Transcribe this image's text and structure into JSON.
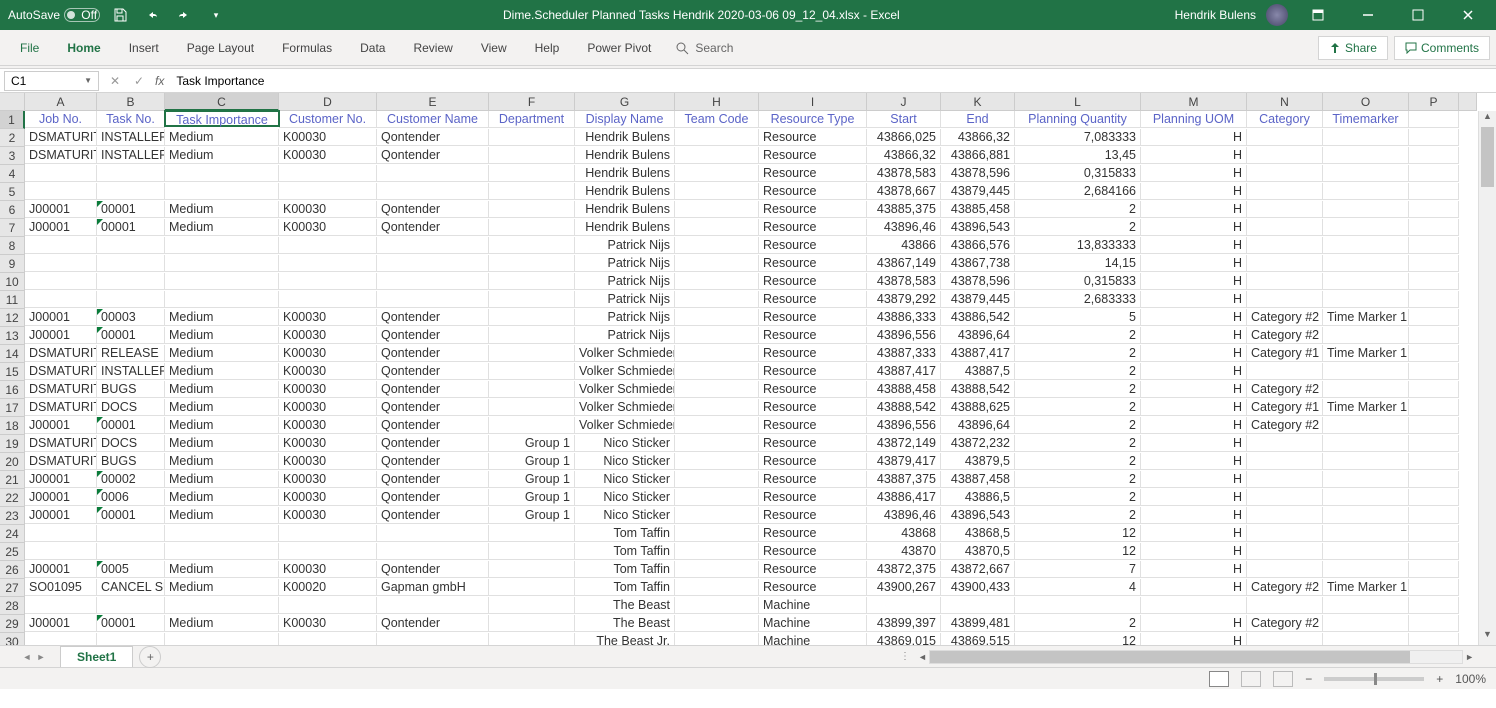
{
  "titlebar": {
    "autosave_label": "AutoSave",
    "autosave_off": "Off",
    "title": "Dime.Scheduler Planned Tasks Hendrik 2020-03-06 09_12_04.xlsx - Excel",
    "user": "Hendrik Bulens"
  },
  "ribbon": {
    "tabs": [
      "File",
      "Home",
      "Insert",
      "Page Layout",
      "Formulas",
      "Data",
      "Review",
      "View",
      "Help",
      "Power Pivot"
    ],
    "search_placeholder": "Search",
    "share": "Share",
    "comments": "Comments"
  },
  "formula_bar": {
    "name_box": "C1",
    "formula": "Task Importance"
  },
  "columns": [
    "A",
    "B",
    "C",
    "D",
    "E",
    "F",
    "G",
    "H",
    "I",
    "J",
    "K",
    "L",
    "M",
    "N",
    "O",
    "P"
  ],
  "headers": [
    "Job No.",
    "Task No.",
    "Task Importance",
    "Customer No.",
    "Customer Name",
    "Department",
    "Display Name",
    "Team Code",
    "Resource Type",
    "Start",
    "End",
    "Planning Quantity",
    "Planning UOM",
    "Category",
    "Timemarker"
  ],
  "rows": [
    {
      "n": 1,
      "job": "DSMATURITY",
      "task": "INSTALLER",
      "imp": "Medium",
      "cust": "K00030",
      "cname": "Qontender",
      "dep": "",
      "disp": "Hendrik Bulens",
      "team": "",
      "rtype": "Resource",
      "start": "43866,025",
      "end": "43866,32",
      "qty": "7,083333",
      "uom": "H",
      "cat": "",
      "tm": ""
    },
    {
      "n": 2,
      "job": "DSMATURITY",
      "task": "INSTALLER",
      "imp": "Medium",
      "cust": "K00030",
      "cname": "Qontender",
      "dep": "",
      "disp": "Hendrik Bulens",
      "team": "",
      "rtype": "Resource",
      "start": "43866,32",
      "end": "43866,881",
      "qty": "13,45",
      "uom": "H",
      "cat": "",
      "tm": ""
    },
    {
      "n": 3,
      "job": "",
      "task": "",
      "imp": "",
      "cust": "",
      "cname": "",
      "dep": "",
      "disp": "Hendrik Bulens",
      "team": "",
      "rtype": "Resource",
      "start": "43878,583",
      "end": "43878,596",
      "qty": "0,315833",
      "uom": "H",
      "cat": "",
      "tm": ""
    },
    {
      "n": 4,
      "job": "",
      "task": "",
      "imp": "",
      "cust": "",
      "cname": "",
      "dep": "",
      "disp": "Hendrik Bulens",
      "team": "",
      "rtype": "Resource",
      "start": "43878,667",
      "end": "43879,445",
      "qty": "2,684166",
      "uom": "H",
      "cat": "",
      "tm": ""
    },
    {
      "n": 5,
      "job": "J00001",
      "task": "00001",
      "imp": "Medium",
      "cust": "K00030",
      "cname": "Qontender",
      "dep": "",
      "disp": "Hendrik Bulens",
      "team": "",
      "rtype": "Resource",
      "start": "43885,375",
      "end": "43885,458",
      "qty": "2",
      "uom": "H",
      "cat": "",
      "tm": "",
      "err": true
    },
    {
      "n": 6,
      "job": "J00001",
      "task": "00001",
      "imp": "Medium",
      "cust": "K00030",
      "cname": "Qontender",
      "dep": "",
      "disp": "Hendrik Bulens",
      "team": "",
      "rtype": "Resource",
      "start": "43896,46",
      "end": "43896,543",
      "qty": "2",
      "uom": "H",
      "cat": "",
      "tm": "",
      "err": true
    },
    {
      "n": 7,
      "job": "",
      "task": "",
      "imp": "",
      "cust": "",
      "cname": "",
      "dep": "",
      "disp": "Patrick Nijs",
      "team": "",
      "rtype": "Resource",
      "start": "43866",
      "end": "43866,576",
      "qty": "13,833333",
      "uom": "H",
      "cat": "",
      "tm": ""
    },
    {
      "n": 8,
      "job": "",
      "task": "",
      "imp": "",
      "cust": "",
      "cname": "",
      "dep": "",
      "disp": "Patrick Nijs",
      "team": "",
      "rtype": "Resource",
      "start": "43867,149",
      "end": "43867,738",
      "qty": "14,15",
      "uom": "H",
      "cat": "",
      "tm": ""
    },
    {
      "n": 9,
      "job": "",
      "task": "",
      "imp": "",
      "cust": "",
      "cname": "",
      "dep": "",
      "disp": "Patrick Nijs",
      "team": "",
      "rtype": "Resource",
      "start": "43878,583",
      "end": "43878,596",
      "qty": "0,315833",
      "uom": "H",
      "cat": "",
      "tm": ""
    },
    {
      "n": 10,
      "job": "",
      "task": "",
      "imp": "",
      "cust": "",
      "cname": "",
      "dep": "",
      "disp": "Patrick Nijs",
      "team": "",
      "rtype": "Resource",
      "start": "43879,292",
      "end": "43879,445",
      "qty": "2,683333",
      "uom": "H",
      "cat": "",
      "tm": ""
    },
    {
      "n": 11,
      "job": "J00001",
      "task": "00003",
      "imp": "Medium",
      "cust": "K00030",
      "cname": "Qontender",
      "dep": "",
      "disp": "Patrick Nijs",
      "team": "",
      "rtype": "Resource",
      "start": "43886,333",
      "end": "43886,542",
      "qty": "5",
      "uom": "H",
      "cat": "Category #2",
      "tm": "Time Marker 1",
      "err": true
    },
    {
      "n": 12,
      "job": "J00001",
      "task": "00001",
      "imp": "Medium",
      "cust": "K00030",
      "cname": "Qontender",
      "dep": "",
      "disp": "Patrick Nijs",
      "team": "",
      "rtype": "Resource",
      "start": "43896,556",
      "end": "43896,64",
      "qty": "2",
      "uom": "H",
      "cat": "Category #2",
      "tm": "",
      "err": true
    },
    {
      "n": 13,
      "job": "DSMATURITY",
      "task": "RELEASE",
      "imp": "Medium",
      "cust": "K00030",
      "cname": "Qontender",
      "dep": "",
      "disp": "Volker Schmieder",
      "team": "",
      "rtype": "Resource",
      "start": "43887,333",
      "end": "43887,417",
      "qty": "2",
      "uom": "H",
      "cat": "Category #1",
      "tm": "Time Marker 1"
    },
    {
      "n": 14,
      "job": "DSMATURITY",
      "task": "INSTALLER",
      "imp": "Medium",
      "cust": "K00030",
      "cname": "Qontender",
      "dep": "",
      "disp": "Volker Schmieder",
      "team": "",
      "rtype": "Resource",
      "start": "43887,417",
      "end": "43887,5",
      "qty": "2",
      "uom": "H",
      "cat": "",
      "tm": ""
    },
    {
      "n": 15,
      "job": "DSMATURITY",
      "task": "BUGS",
      "imp": "Medium",
      "cust": "K00030",
      "cname": "Qontender",
      "dep": "",
      "disp": "Volker Schmieder",
      "team": "",
      "rtype": "Resource",
      "start": "43888,458",
      "end": "43888,542",
      "qty": "2",
      "uom": "H",
      "cat": "Category #2",
      "tm": ""
    },
    {
      "n": 16,
      "job": "DSMATURITY",
      "task": "DOCS",
      "imp": "Medium",
      "cust": "K00030",
      "cname": "Qontender",
      "dep": "",
      "disp": "Volker Schmieder",
      "team": "",
      "rtype": "Resource",
      "start": "43888,542",
      "end": "43888,625",
      "qty": "2",
      "uom": "H",
      "cat": "Category #1",
      "tm": "Time Marker 1"
    },
    {
      "n": 17,
      "job": "J00001",
      "task": "00001",
      "imp": "Medium",
      "cust": "K00030",
      "cname": "Qontender",
      "dep": "",
      "disp": "Volker Schmieder",
      "team": "",
      "rtype": "Resource",
      "start": "43896,556",
      "end": "43896,64",
      "qty": "2",
      "uom": "H",
      "cat": "Category #2",
      "tm": "",
      "err": true
    },
    {
      "n": 18,
      "job": "DSMATURITY",
      "task": "DOCS",
      "imp": "Medium",
      "cust": "K00030",
      "cname": "Qontender",
      "dep": "Group 1",
      "disp": "Nico Sticker",
      "team": "",
      "rtype": "Resource",
      "start": "43872,149",
      "end": "43872,232",
      "qty": "2",
      "uom": "H",
      "cat": "",
      "tm": ""
    },
    {
      "n": 19,
      "job": "DSMATURITY",
      "task": "BUGS",
      "imp": "Medium",
      "cust": "K00030",
      "cname": "Qontender",
      "dep": "Group 1",
      "disp": "Nico Sticker",
      "team": "",
      "rtype": "Resource",
      "start": "43879,417",
      "end": "43879,5",
      "qty": "2",
      "uom": "H",
      "cat": "",
      "tm": ""
    },
    {
      "n": 20,
      "job": "J00001",
      "task": "00002",
      "imp": "Medium",
      "cust": "K00030",
      "cname": "Qontender",
      "dep": "Group 1",
      "disp": "Nico Sticker",
      "team": "",
      "rtype": "Resource",
      "start": "43887,375",
      "end": "43887,458",
      "qty": "2",
      "uom": "H",
      "cat": "",
      "tm": "",
      "err": true
    },
    {
      "n": 21,
      "job": "J00001",
      "task": "0006",
      "imp": "Medium",
      "cust": "K00030",
      "cname": "Qontender",
      "dep": "Group 1",
      "disp": "Nico Sticker",
      "team": "",
      "rtype": "Resource",
      "start": "43886,417",
      "end": "43886,5",
      "qty": "2",
      "uom": "H",
      "cat": "",
      "tm": "",
      "err": true
    },
    {
      "n": 22,
      "job": "J00001",
      "task": "00001",
      "imp": "Medium",
      "cust": "K00030",
      "cname": "Qontender",
      "dep": "Group 1",
      "disp": "Nico Sticker",
      "team": "",
      "rtype": "Resource",
      "start": "43896,46",
      "end": "43896,543",
      "qty": "2",
      "uom": "H",
      "cat": "",
      "tm": "",
      "err": true
    },
    {
      "n": 23,
      "job": "",
      "task": "",
      "imp": "",
      "cust": "",
      "cname": "",
      "dep": "",
      "disp": "Tom Taffin",
      "team": "",
      "rtype": "Resource",
      "start": "43868",
      "end": "43868,5",
      "qty": "12",
      "uom": "H",
      "cat": "",
      "tm": ""
    },
    {
      "n": 24,
      "job": "",
      "task": "",
      "imp": "",
      "cust": "",
      "cname": "",
      "dep": "",
      "disp": "Tom Taffin",
      "team": "",
      "rtype": "Resource",
      "start": "43870",
      "end": "43870,5",
      "qty": "12",
      "uom": "H",
      "cat": "",
      "tm": ""
    },
    {
      "n": 25,
      "job": "J00001",
      "task": "0005",
      "imp": "Medium",
      "cust": "K00030",
      "cname": "Qontender",
      "dep": "",
      "disp": "Tom Taffin",
      "team": "",
      "rtype": "Resource",
      "start": "43872,375",
      "end": "43872,667",
      "qty": "7",
      "uom": "H",
      "cat": "",
      "tm": "",
      "err": true
    },
    {
      "n": 26,
      "job": "SO01095",
      "task": "CANCEL SUB",
      "imp": "Medium",
      "cust": "K00020",
      "cname": "Gapman gmbH",
      "dep": "",
      "disp": "Tom Taffin",
      "team": "",
      "rtype": "Resource",
      "start": "43900,267",
      "end": "43900,433",
      "qty": "4",
      "uom": "H",
      "cat": "Category #2",
      "tm": "Time Marker 1"
    },
    {
      "n": 27,
      "job": "",
      "task": "",
      "imp": "",
      "cust": "",
      "cname": "",
      "dep": "",
      "disp": "The Beast",
      "team": "",
      "rtype": "Machine",
      "start": "",
      "end": "",
      "qty": "",
      "uom": "",
      "cat": "",
      "tm": ""
    },
    {
      "n": 28,
      "job": "J00001",
      "task": "00001",
      "imp": "Medium",
      "cust": "K00030",
      "cname": "Qontender",
      "dep": "",
      "disp": "The Beast",
      "team": "",
      "rtype": "Machine",
      "start": "43899,397",
      "end": "43899,481",
      "qty": "2",
      "uom": "H",
      "cat": "Category #2",
      "tm": "",
      "err": true
    },
    {
      "n": 29,
      "job": "",
      "task": "",
      "imp": "",
      "cust": "",
      "cname": "",
      "dep": "",
      "disp": "The Beast Jr.",
      "team": "",
      "rtype": "Machine",
      "start": "43869,015",
      "end": "43869,515",
      "qty": "12",
      "uom": "H",
      "cat": "",
      "tm": ""
    }
  ],
  "sheets": {
    "active": "Sheet1"
  },
  "statusbar": {
    "zoom": "100%"
  }
}
